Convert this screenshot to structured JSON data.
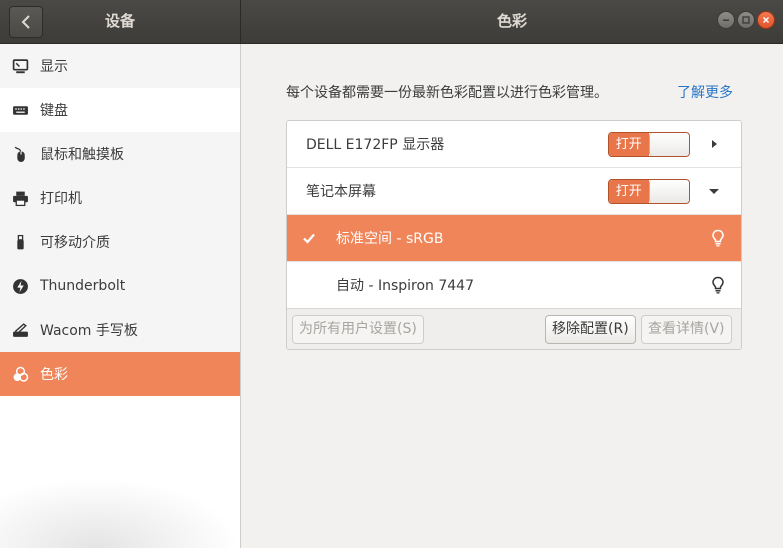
{
  "header": {
    "left_title": "设备",
    "right_title": "色彩"
  },
  "sidebar": {
    "items": [
      {
        "label": "显示",
        "icon": "display-icon"
      },
      {
        "label": "键盘",
        "icon": "keyboard-icon"
      },
      {
        "label": "鼠标和触摸板",
        "icon": "mouse-icon"
      },
      {
        "label": "打印机",
        "icon": "printer-icon"
      },
      {
        "label": "可移动介质",
        "icon": "usb-drive-icon"
      },
      {
        "label": "Thunderbolt",
        "icon": "thunderbolt-icon"
      },
      {
        "label": "Wacom 手写板",
        "icon": "tablet-icon"
      },
      {
        "label": "色彩",
        "icon": "color-icon",
        "active": true
      }
    ]
  },
  "main": {
    "description": "每个设备都需要一份最新色彩配置以进行色彩管理。",
    "learn_more": "了解更多",
    "devices": [
      {
        "name": "DELL E172FP 显示器",
        "switch_label": "打开",
        "expanded": false
      },
      {
        "name": "笔记本屏幕",
        "switch_label": "打开",
        "expanded": true
      }
    ],
    "profiles": [
      {
        "name": "标准空间 - sRGB",
        "selected": true
      },
      {
        "name": "自动 - Inspiron 7447",
        "selected": false
      }
    ],
    "toolbar": {
      "set_all_users": "为所有用户设置(S)",
      "remove_profile": "移除配置(R)",
      "view_details": "查看详情(V)"
    }
  },
  "colors": {
    "accent": "#f0855a",
    "link": "#2a76c6",
    "header_bg": "#3d3c38"
  }
}
